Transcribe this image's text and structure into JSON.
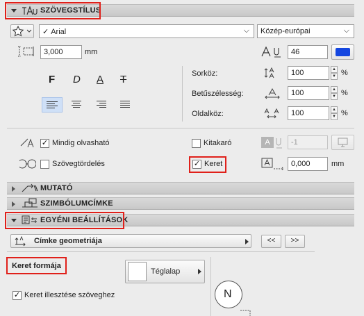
{
  "section_text_style": {
    "title": "SZÖVEGSTÍLUS"
  },
  "font": {
    "name": "Arial",
    "script": "Közép-európai",
    "size_value": "3,000",
    "size_unit": "mm",
    "pen_value": "46",
    "pen_color": "#1446e0"
  },
  "format_buttons": {
    "bold": "F",
    "italic": "D",
    "underline": "A",
    "strike": "T"
  },
  "spacing": {
    "line_label": "Sorköz:",
    "line_value": "100",
    "width_label": "Betűszélesség:",
    "width_value": "100",
    "char_label": "Oldalköz:",
    "char_value": "100",
    "unit": "%"
  },
  "options": {
    "always_readable": "Mindig olvasható",
    "always_readable_checked": true,
    "wrap": "Szövegtördelés",
    "wrap_checked": false,
    "opaque": "Kitakaró",
    "opaque_checked": false,
    "opaque_value": "-1",
    "frame": "Keret",
    "frame_checked": true,
    "frame_offset_value": "0,000",
    "frame_offset_unit": "mm"
  },
  "sections": {
    "pointer": "MUTATÓ",
    "symbol_label": "SZIMBÓLUMCÍMKE",
    "custom": "EGYÉNI BEÁLLÍTÁSOK"
  },
  "custom": {
    "geometry_label": "Címke geometriája",
    "prev_label": "<<",
    "next_label": ">>",
    "frame_shape_label": "Keret formája",
    "frame_shape_value": "Téglalap",
    "fit_frame_label": "Keret illesztése szöveghez",
    "fit_frame_checked": true,
    "preview_letter": "N"
  },
  "colors": {
    "highlight": "#e0201a",
    "accent": "#1446e0"
  }
}
